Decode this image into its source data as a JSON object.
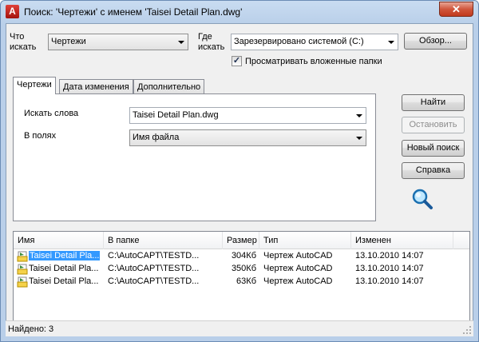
{
  "window": {
    "title": "Поиск: 'Чертежи' с именем 'Taisei Detail Plan.dwg'",
    "app_icon": "A",
    "close_icon": "✕"
  },
  "search": {
    "what_label_1": "Что",
    "what_label_2": "искать",
    "what_value": "Чертежи",
    "where_label_1": "Где",
    "where_label_2": "искать",
    "where_value": "Зарезервировано системой (C:)",
    "browse_label": "Обзор...",
    "subfolders_label": "Просматривать вложенные папки",
    "subfolders_checked": true
  },
  "tabs": [
    "Чертежи",
    "Дата изменения",
    "Дополнительно"
  ],
  "drawings_tab": {
    "words_label": "Искать слова",
    "words_value": "Taisei Detail Plan.dwg",
    "fields_label": "В полях",
    "fields_value": "Имя файла"
  },
  "buttons": {
    "find": "Найти",
    "stop": "Остановить",
    "new_search": "Новый поиск",
    "help": "Справка"
  },
  "results": {
    "columns": [
      "Имя",
      "В папке",
      "Размер",
      "Тип",
      "Изменен"
    ],
    "rows": [
      {
        "name": "Taisei Detail Pla...",
        "folder": "C:\\AutoCAPT\\TESTD...",
        "size": "304Кб",
        "type": "Чертеж AutoCAD",
        "modified": "13.10.2010 14:07"
      },
      {
        "name": "Taisei Detail Pla...",
        "folder": "C:\\AutoCAPT\\TESTD...",
        "size": "350Кб",
        "type": "Чертеж AutoCAD",
        "modified": "13.10.2010 14:07"
      },
      {
        "name": "Taisei Detail Pla...",
        "folder": "C:\\AutoCAPT\\TESTD...",
        "size": "63Кб",
        "type": "Чертеж AutoCAD",
        "modified": "13.10.2010 14:07"
      }
    ]
  },
  "status": {
    "found_text": "Найдено: 3"
  },
  "colors": {
    "selection": "#3399ff",
    "titlebar": "#b9cfe9"
  }
}
